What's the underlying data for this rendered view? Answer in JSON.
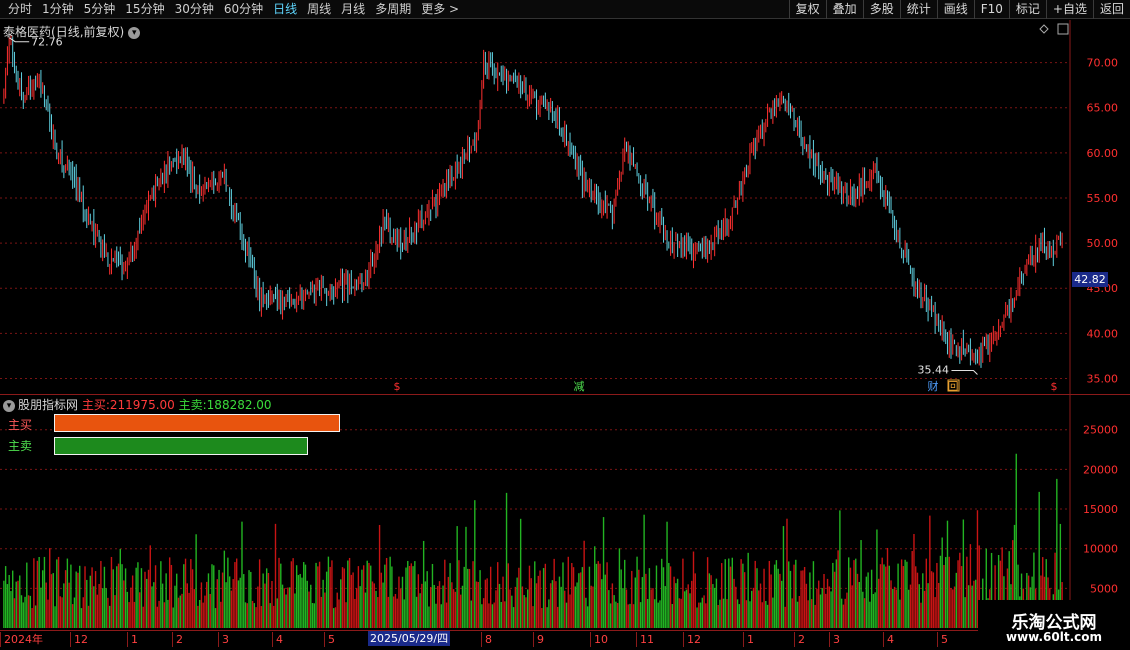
{
  "toolbar": {
    "periods": [
      "分时",
      "1分钟",
      "5分钟",
      "15分钟",
      "30分钟",
      "60分钟",
      "日线",
      "周线",
      "月线",
      "多周期",
      "更多"
    ],
    "active_period": "日线",
    "more_arrow": ">",
    "tools": [
      "复权",
      "叠加",
      "多股",
      "统计",
      "画线",
      "F10",
      "标记",
      "+自选",
      "返回"
    ]
  },
  "main_chart": {
    "stock_name": "泰格医药",
    "chart_mode": "(日线,前复权)",
    "high_label": "72.76",
    "low_label": "35.44",
    "current_price": "42.82",
    "markers": [
      "$",
      "减",
      "财",
      "回",
      "$"
    ],
    "colors": {
      "up": "#ff3030",
      "down": "#5fd0e0",
      "grid": "#7a1414",
      "axis_text": "#ff3030"
    }
  },
  "indicator": {
    "name": "股朋指标网",
    "buy_label": "主买:",
    "buy_value": "211975.00",
    "sell_label": "主卖:",
    "sell_value": "188282.00",
    "buy_row_label": "主买",
    "sell_row_label": "主卖",
    "buy_ratio": 0.5297,
    "sell_ratio": 0.4703
  },
  "date_axis": {
    "ticks": [
      "2024年",
      "12",
      "1",
      "2",
      "3",
      "4",
      "5",
      "2025/05/29/四",
      "8",
      "9",
      "10",
      "11",
      "12",
      "1",
      "2",
      "3",
      "4",
      "5"
    ]
  },
  "watermark": {
    "title": "乐淘公式网",
    "url": "www.60lt.com"
  },
  "chart_data": [
    {
      "type": "candlestick",
      "title": "泰格医药(日线,前复权)",
      "y_ticks": [
        35.0,
        40.0,
        45.0,
        50.0,
        55.0,
        60.0,
        65.0,
        70.0
      ],
      "ylim": [
        33.5,
        74.5
      ],
      "trend": [
        [
          0,
          66
        ],
        [
          3,
          72.8
        ],
        [
          10,
          66
        ],
        [
          20,
          68
        ],
        [
          30,
          60
        ],
        [
          40,
          57
        ],
        [
          55,
          49
        ],
        [
          70,
          47.5
        ],
        [
          85,
          56
        ],
        [
          100,
          60
        ],
        [
          110,
          56
        ],
        [
          125,
          57
        ],
        [
          135,
          51
        ],
        [
          145,
          44
        ],
        [
          160,
          43.5
        ],
        [
          175,
          44.5
        ],
        [
          190,
          45
        ],
        [
          205,
          46
        ],
        [
          215,
          52
        ],
        [
          225,
          50
        ],
        [
          240,
          53
        ],
        [
          255,
          58
        ],
        [
          268,
          61
        ],
        [
          272,
          70
        ],
        [
          285,
          68
        ],
        [
          300,
          66
        ],
        [
          310,
          65
        ],
        [
          318,
          62
        ],
        [
          330,
          56
        ],
        [
          345,
          53
        ],
        [
          352,
          61
        ],
        [
          365,
          55
        ],
        [
          378,
          50
        ],
        [
          395,
          49
        ],
        [
          410,
          52
        ],
        [
          422,
          59
        ],
        [
          432,
          64
        ],
        [
          442,
          66
        ],
        [
          452,
          62
        ],
        [
          465,
          57
        ],
        [
          480,
          55
        ],
        [
          495,
          58
        ],
        [
          505,
          52
        ],
        [
          515,
          46
        ],
        [
          525,
          43
        ],
        [
          535,
          39
        ],
        [
          545,
          38
        ],
        [
          552,
          37
        ],
        [
          562,
          40
        ],
        [
          572,
          44
        ],
        [
          582,
          48
        ],
        [
          588,
          50
        ],
        [
          595,
          49
        ],
        [
          600,
          51
        ]
      ],
      "high": {
        "value": 72.76
      },
      "low": {
        "value": 35.44
      },
      "last": {
        "value": 42.82
      }
    },
    {
      "type": "bar",
      "title": "股朋指标网",
      "series": [
        {
          "name": "主买",
          "total": 211975.0
        },
        {
          "name": "主卖",
          "total": 188282.0
        }
      ],
      "y_ticks": [
        5000,
        10000,
        15000,
        20000,
        25000
      ],
      "ylim": [
        0,
        29000
      ]
    }
  ]
}
